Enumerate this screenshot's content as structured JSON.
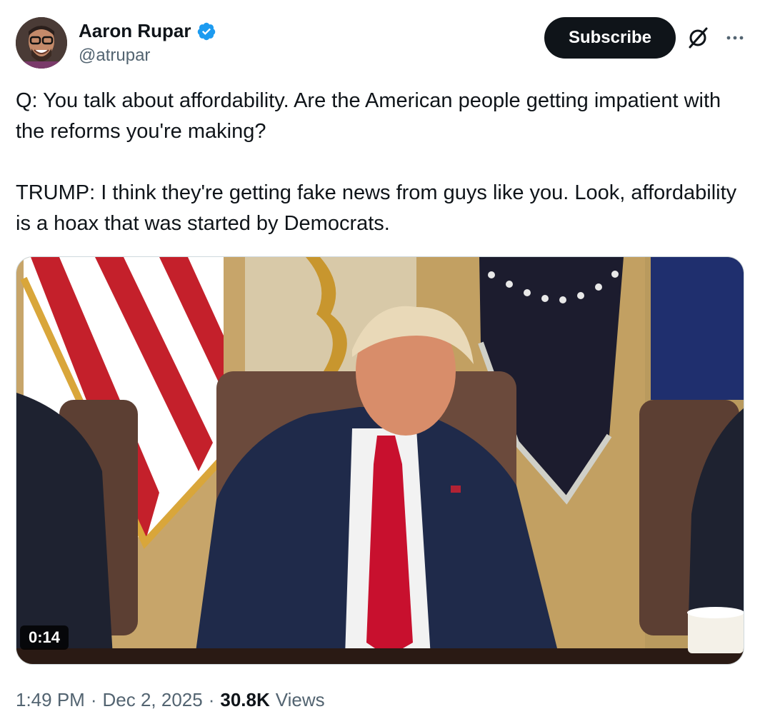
{
  "author": {
    "name": "Aaron Rupar",
    "handle": "@atrupar",
    "verified": true,
    "verified_color": "#1d9bf0"
  },
  "actions": {
    "subscribe_label": "Subscribe",
    "grok_icon": "grok-icon",
    "more_icon": "more-icon"
  },
  "tweet": {
    "text": "Q: You talk about affordability. Are the American people getting impatient with the reforms you're making?\n\nTRUMP: I think they're getting fake news from guys like you. Look, affordability is a hoax that was started by Democrats."
  },
  "media": {
    "type": "video",
    "duration": "0:14"
  },
  "meta": {
    "time": "1:49 PM",
    "date": "Dec 2, 2025",
    "views_count": "30.8K",
    "views_label": "Views",
    "separator": "·"
  },
  "colors": {
    "text_primary": "#0f1419",
    "text_secondary": "#536471",
    "button_bg": "#0f1419"
  }
}
